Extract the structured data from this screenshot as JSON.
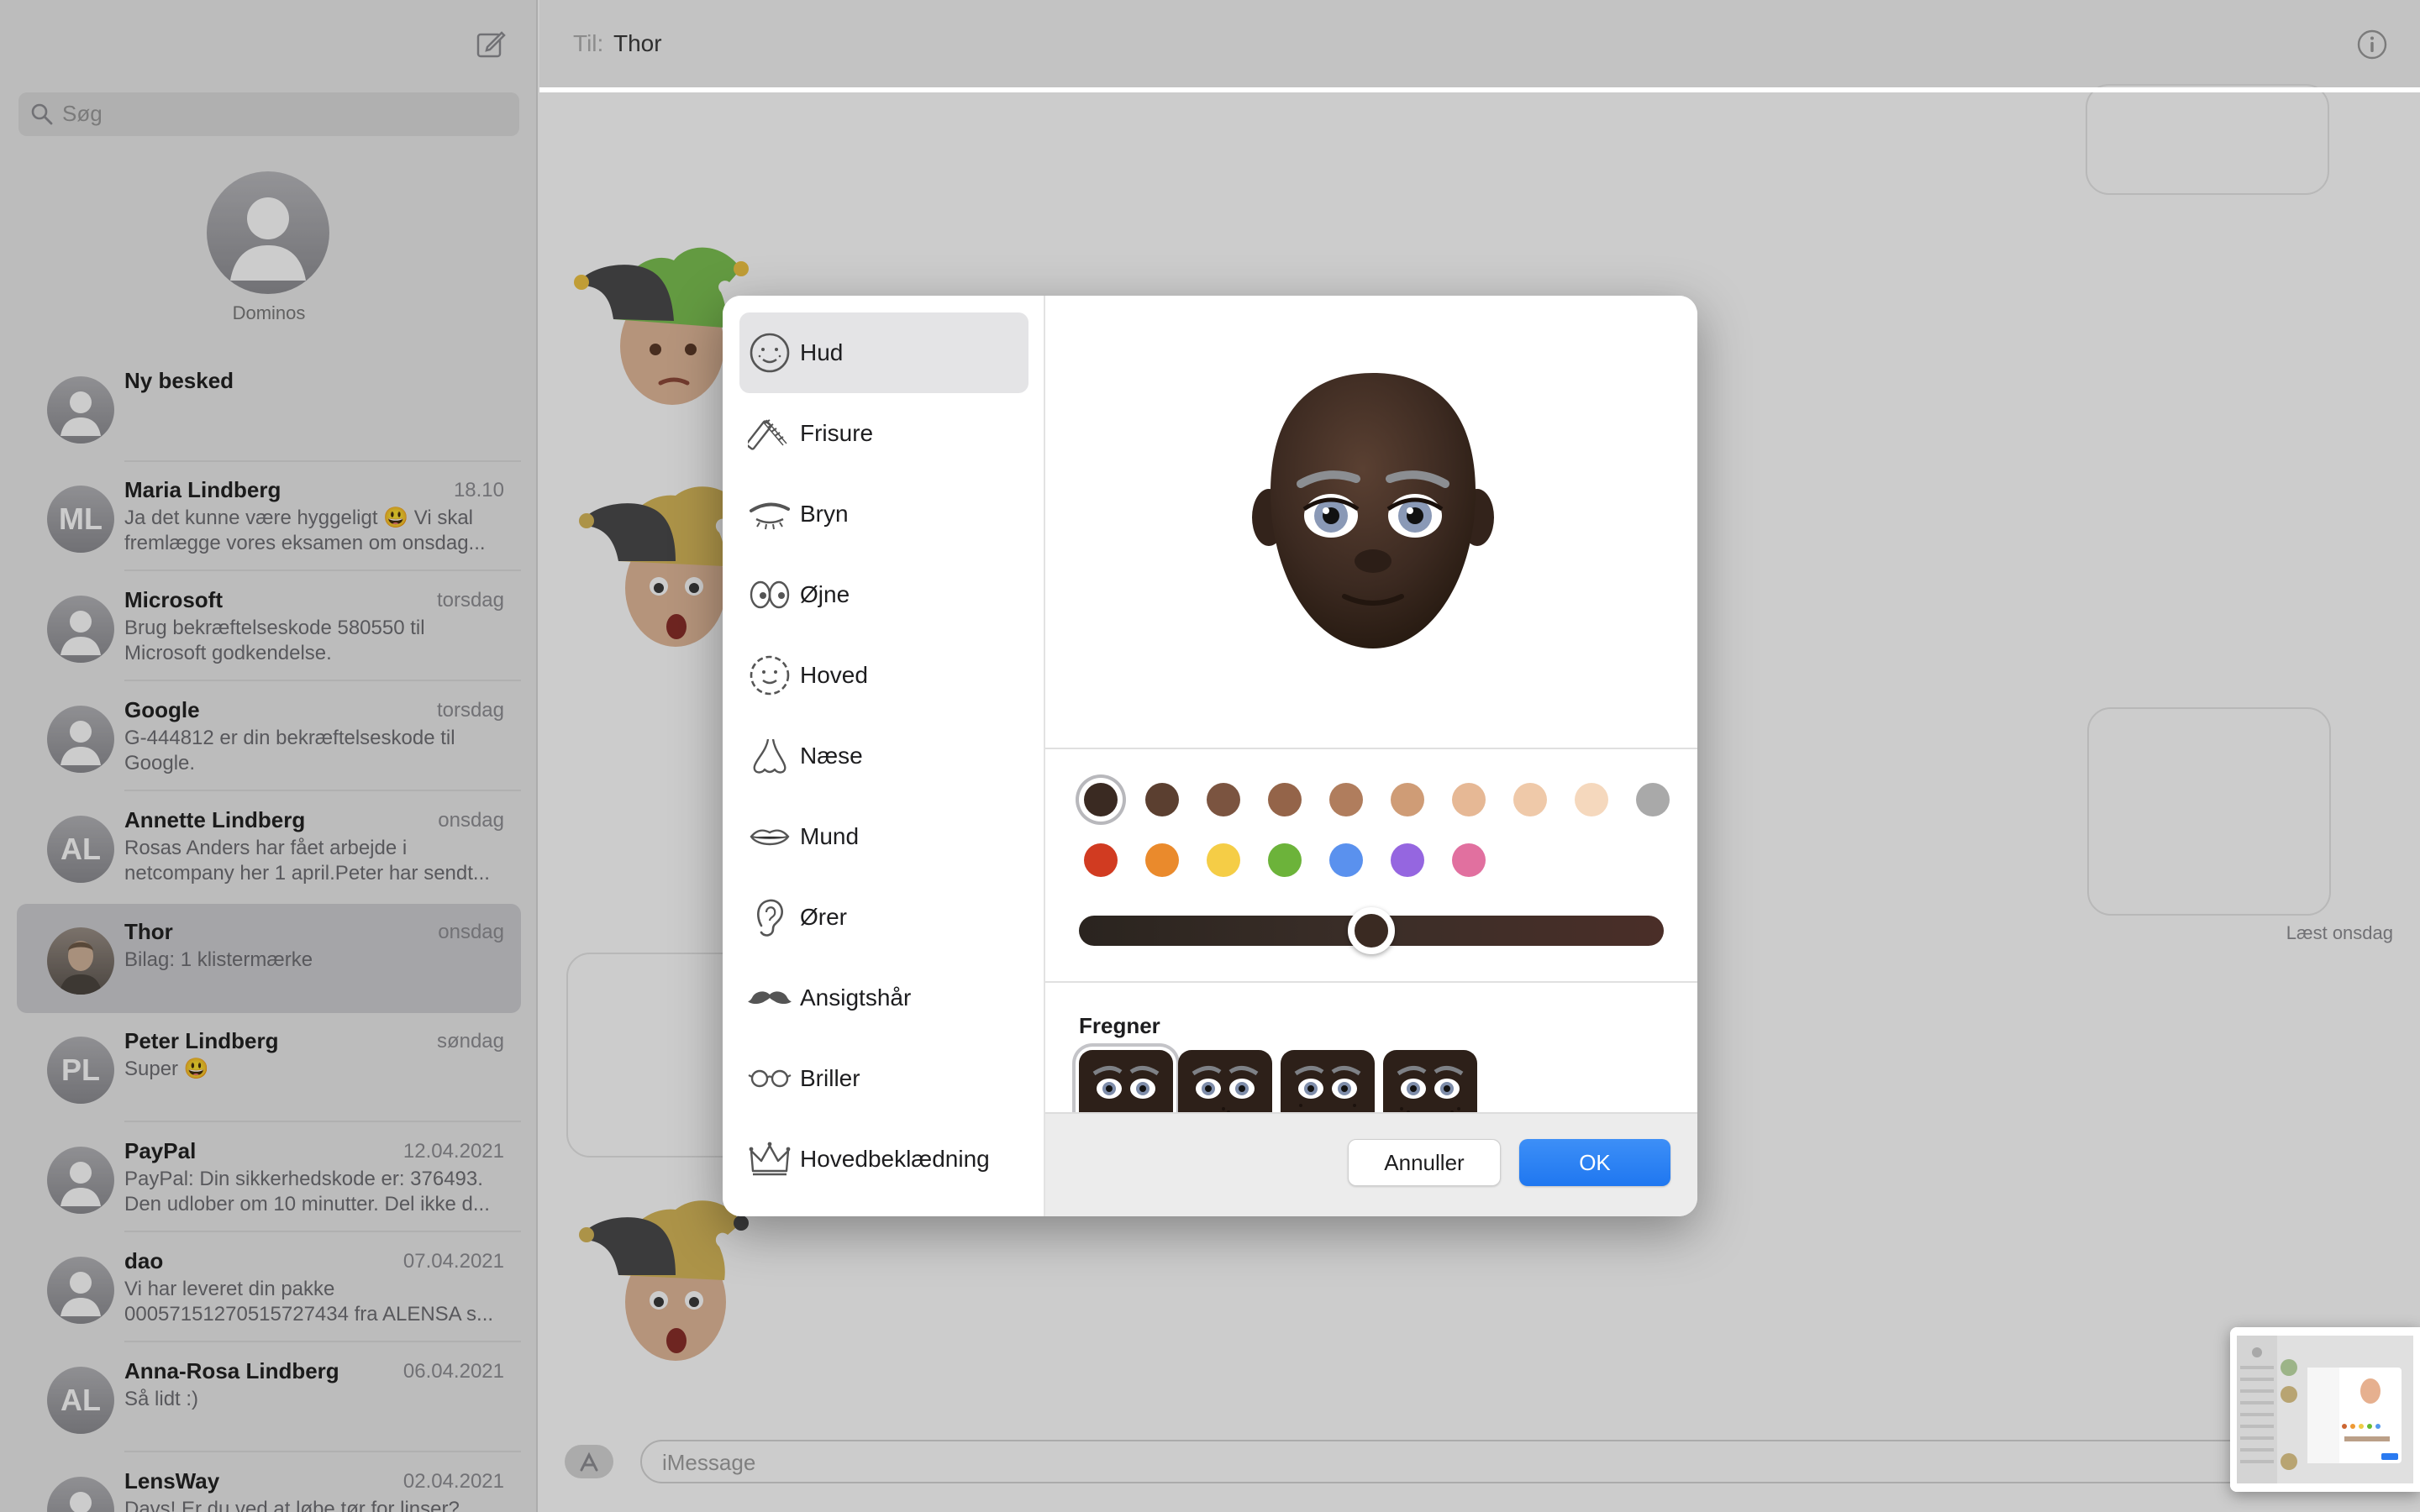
{
  "sidebar": {
    "search_placeholder": "Søg",
    "pinned": {
      "name": "Dominos"
    },
    "conversations": [
      {
        "sender": "Ny besked",
        "date": "",
        "preview": "",
        "initials": ""
      },
      {
        "sender": "Maria Lindberg",
        "date": "18.10",
        "preview": "Ja det kunne være hyggeligt 😃 Vi skal fremlægge vores eksamen om onsdag...",
        "initials": "ML"
      },
      {
        "sender": "Microsoft",
        "date": "torsdag",
        "preview": "Brug bekræftelseskode 580550 til Microsoft godkendelse.",
        "initials": ""
      },
      {
        "sender": "Google",
        "date": "torsdag",
        "preview": "G-444812 er din bekræftelseskode til Google.",
        "initials": ""
      },
      {
        "sender": "Annette Lindberg",
        "date": "onsdag",
        "preview": "Rosas Anders har fået arbejde i netcompany her 1 april.Peter har sendt...",
        "initials": "AL"
      },
      {
        "sender": "Thor",
        "date": "onsdag",
        "preview": "Bilag: 1 klistermærke",
        "initials": ""
      },
      {
        "sender": "Peter Lindberg",
        "date": "søndag",
        "preview": "Super 😃",
        "initials": "PL"
      },
      {
        "sender": "PayPal",
        "date": "12.04.2021",
        "preview": "PayPal: Din sikkerhedskode er: 376493. Den udlober om 10 minutter. Del ikke d...",
        "initials": ""
      },
      {
        "sender": "dao",
        "date": "07.04.2021",
        "preview": "Vi har leveret din pakke 00057151270515727434 fra ALENSA s...",
        "initials": ""
      },
      {
        "sender": "Anna-Rosa Lindberg",
        "date": "06.04.2021",
        "preview": "Så lidt :)",
        "initials": "AL"
      },
      {
        "sender": "LensWay",
        "date": "02.04.2021",
        "preview": "Davs! Er du ved at løbe tør for linser?",
        "initials": ""
      }
    ]
  },
  "header": {
    "to_label": "Til:",
    "to_name": "Thor"
  },
  "conversation": {
    "read_receipt": "Læst onsdag",
    "input_placeholder": "iMessage"
  },
  "memoji_editor": {
    "categories": [
      {
        "label": "Hud",
        "icon": "face-freckles-icon"
      },
      {
        "label": "Frisure",
        "icon": "comb-icon"
      },
      {
        "label": "Bryn",
        "icon": "eyebrow-icon"
      },
      {
        "label": "Øjne",
        "icon": "eyes-icon"
      },
      {
        "label": "Hoved",
        "icon": "head-outline-icon"
      },
      {
        "label": "Næse",
        "icon": "nose-icon"
      },
      {
        "label": "Mund",
        "icon": "lips-icon"
      },
      {
        "label": "Ører",
        "icon": "ear-icon"
      },
      {
        "label": "Ansigtshår",
        "icon": "mustache-icon"
      },
      {
        "label": "Briller",
        "icon": "glasses-icon"
      },
      {
        "label": "Hovedbeklædning",
        "icon": "crown-icon"
      }
    ],
    "selected_category": "Hud",
    "skin_colors": [
      "#3a2a22",
      "#5b3f30",
      "#7b5440",
      "#946449",
      "#b07d5d",
      "#cf9c76",
      "#e6b895",
      "#efc9a9",
      "#f5d8bd",
      "#a9a9a9"
    ],
    "accent_colors": [
      "#d13b21",
      "#ea8a2c",
      "#f5cd46",
      "#6cb33a",
      "#5a91ee",
      "#9566e0",
      "#e1709f"
    ],
    "selected_color_index": 0,
    "tone_slider_value": 0.5,
    "freckles_title": "Fregner",
    "freckle_options_count": 4,
    "cancel_label": "Annuller",
    "ok_label": "OK"
  }
}
